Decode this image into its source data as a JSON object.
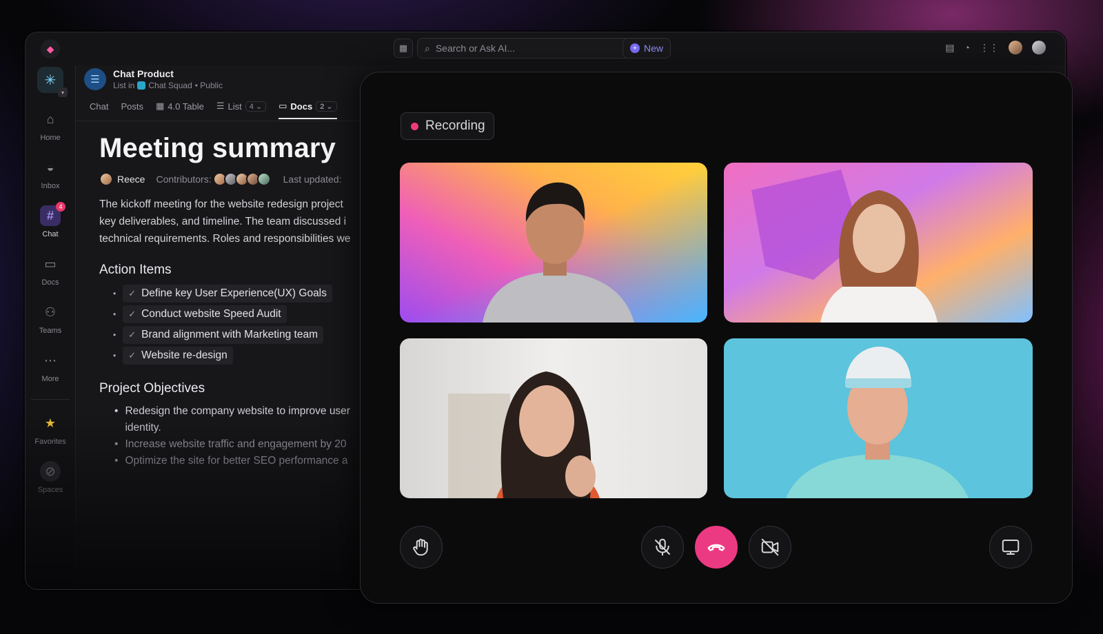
{
  "topbar": {
    "search_placeholder": "Search or Ask AI...",
    "new_label": "New",
    "icons": [
      "calendar-icon",
      "sparkle-icon",
      "clipboard-icon",
      "timer-icon",
      "apps-grid-icon"
    ]
  },
  "sidebar": {
    "items": [
      {
        "label": "Home",
        "icon": "home-icon"
      },
      {
        "label": "Inbox",
        "icon": "inbox-icon"
      },
      {
        "label": "Chat",
        "icon": "hash-icon",
        "badge": "4"
      },
      {
        "label": "Docs",
        "icon": "doc-icon"
      },
      {
        "label": "Teams",
        "icon": "people-icon"
      },
      {
        "label": "More",
        "icon": "more-icon"
      },
      {
        "label": "Favorites",
        "icon": "star-icon"
      },
      {
        "label": "Spaces",
        "icon": "compass-icon"
      }
    ]
  },
  "list": {
    "title": "Chat Product",
    "sub_prefix": "List in",
    "space": "Chat Squad",
    "visibility": "• Public"
  },
  "tabs": [
    {
      "label": "Chat"
    },
    {
      "label": "Posts"
    },
    {
      "label": "4.0 Table"
    },
    {
      "label": "List",
      "count": "4"
    },
    {
      "label": "Docs",
      "count": "2"
    }
  ],
  "doc": {
    "title": "Meeting summary",
    "author": "Reece",
    "contributors_label": "Contributors:",
    "last_updated_label": "Last updated:",
    "paragraph": [
      "The kickoff meeting for the website redesign project",
      "key deliverables, and timeline. The team discussed i",
      "technical requirements. Roles and responsibilities we"
    ],
    "action_items_heading": "Action Items",
    "action_items": [
      "Define key User Experience(UX) Goals",
      "Conduct website Speed Audit",
      "Brand alignment with Marketing team",
      "Website re-design"
    ],
    "objectives_heading": "Project Objectives",
    "objectives": [
      "Redesign the company website to improve user",
      "identity.",
      "Increase website traffic and engagement by 20",
      "Optimize the site for better SEO performance a"
    ]
  },
  "call": {
    "recording_label": "Recording",
    "controls": [
      "raise-hand-icon",
      "mic-off-icon",
      "hang-up-icon",
      "camera-off-icon",
      "screen-share-icon"
    ],
    "colors": {
      "hang_up": "#ec3a82",
      "recording_dot": "#f03a78"
    }
  }
}
